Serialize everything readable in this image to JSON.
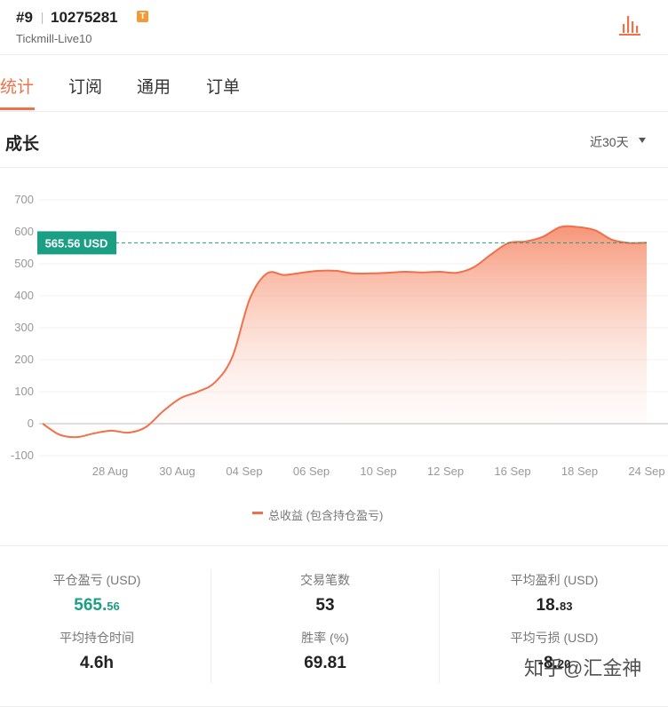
{
  "header": {
    "rank": "#9",
    "account": "10275281",
    "badge": "T",
    "server": "Tickmill-Live10",
    "chart_icon": "bar-chart-icon"
  },
  "tabs": [
    {
      "label": "统计",
      "active": true
    },
    {
      "label": "订阅",
      "active": false
    },
    {
      "label": "通用",
      "active": false
    },
    {
      "label": "订单",
      "active": false
    }
  ],
  "section": {
    "title": "成长",
    "range": "近30天"
  },
  "colors": {
    "accent": "#f0704a",
    "positive": "#1a9f85",
    "badge": "#f29a38"
  },
  "chart_data": {
    "type": "area",
    "y_ticks": [
      "700",
      "600",
      "500",
      "400",
      "300",
      "200",
      "100",
      "0",
      "-100"
    ],
    "ylim": [
      -100,
      700
    ],
    "x_tick_labels": [
      "28 Aug",
      "30 Aug",
      "04 Sep",
      "06 Sep",
      "10 Sep",
      "12 Sep",
      "16 Sep",
      "18 Sep",
      "24 Sep"
    ],
    "current_label": "565.56 USD",
    "current_value": 565.56,
    "series": [
      {
        "name": "总收益 (包含持仓盈亏)",
        "values": [
          0,
          -35,
          -42,
          -30,
          -22,
          -28,
          -10,
          40,
          80,
          100,
          130,
          210,
          390,
          470,
          465,
          472,
          478,
          478,
          470,
          470,
          472,
          475,
          473,
          475,
          472,
          490,
          530,
          565,
          570,
          585,
          615,
          615,
          605,
          575,
          565,
          566
        ]
      }
    ],
    "grid": true,
    "legend_position": "bottom"
  },
  "stats": [
    {
      "label": "平仓盈亏 (USD)",
      "int": "565.",
      "dec": "56",
      "green": true
    },
    {
      "label": "交易笔数",
      "int": "53",
      "dec": "",
      "green": false
    },
    {
      "label": "平均盈利 (USD)",
      "int": "18.",
      "dec": "83",
      "green": false
    },
    {
      "label": "平均持仓时间",
      "int": "4.6h",
      "dec": "",
      "green": false
    },
    {
      "label": "胜率 (%)",
      "int": "69.81",
      "dec": "",
      "green": false
    },
    {
      "label": "平均亏损 (USD)",
      "int": "-8.",
      "dec": "20",
      "green": false
    }
  ],
  "watermark": "知乎@汇金神"
}
